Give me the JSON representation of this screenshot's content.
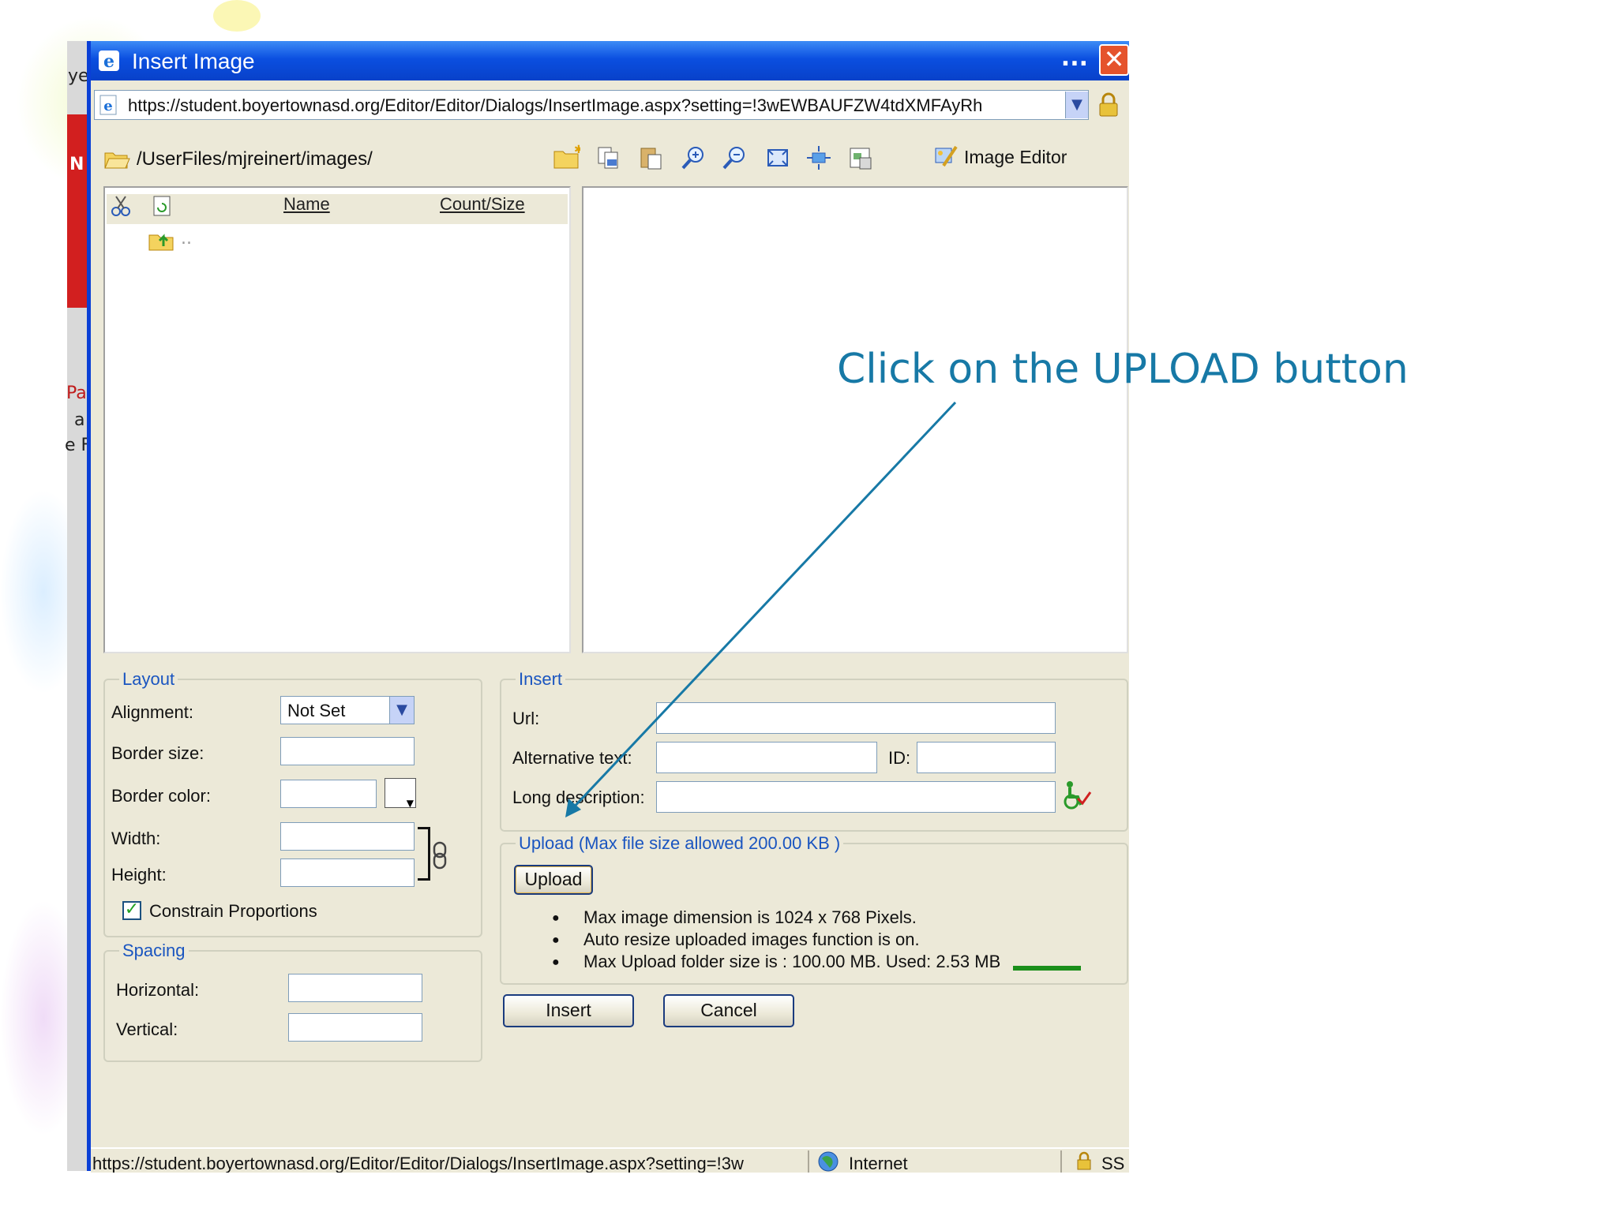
{
  "annotation": {
    "text": "Click on the UPLOAD button"
  },
  "background_window": {
    "fragments": [
      "ye",
      "N",
      "Pa",
      "a",
      "e F"
    ]
  },
  "dialog": {
    "title": "Insert Image",
    "title_menu": "...",
    "close_label": "✕",
    "address": {
      "url": "https://student.boyertownasd.org/Editor/Editor/Dialogs/InsertImage.aspx?setting=!3wEWBAUFZW4tdXMFAyRh"
    },
    "toolbar": {
      "path": "/UserFiles/mjreinert/images/",
      "image_editor_label": "Image Editor",
      "icons": [
        "new-folder-icon",
        "copy-icon",
        "paste-icon",
        "zoom-in-icon",
        "zoom-out-icon",
        "best-fit-icon",
        "actual-size-icon",
        "properties-icon",
        "image-editor-icon"
      ]
    },
    "file_browser": {
      "columns": {
        "name": "Name",
        "count_size": "Count/Size"
      },
      "rows": [
        {
          "label": ".."
        }
      ]
    },
    "layout": {
      "legend": "Layout",
      "alignment_label": "Alignment:",
      "alignment_value": "Not Set",
      "border_size_label": "Border size:",
      "border_color_label": "Border color:",
      "width_label": "Width:",
      "height_label": "Height:",
      "constrain_label": "Constrain Proportions",
      "constrain_checked": true
    },
    "spacing": {
      "legend": "Spacing",
      "horizontal_label": "Horizontal:",
      "vertical_label": "Vertical:"
    },
    "insert": {
      "legend": "Insert",
      "url_label": "Url:",
      "alt_label": "Alternative text:",
      "id_label": "ID:",
      "longdesc_label": "Long description:"
    },
    "upload": {
      "legend": "Upload (Max file size allowed 200.00 KB )",
      "button_label": "Upload",
      "notes": [
        "Max image dimension is 1024 x 768 Pixels.",
        "Auto resize uploaded images function is on.",
        "Max Upload folder size is : 100.00 MB. Used: 2.53 MB"
      ],
      "used_bar_color": "#1a8f1a",
      "used_fraction": 0.0253
    },
    "buttons": {
      "insert": "Insert",
      "cancel": "Cancel"
    },
    "statusbar": {
      "url": "https://student.boyertownasd.org/Editor/Editor/Dialogs/InsertImage.aspx?setting=!3w",
      "zone": "Internet",
      "ssl": "SS"
    }
  },
  "colors": {
    "title_blue": "#0b4fe0",
    "legend_blue": "#1a55c0",
    "annotation": "#1779a6"
  }
}
